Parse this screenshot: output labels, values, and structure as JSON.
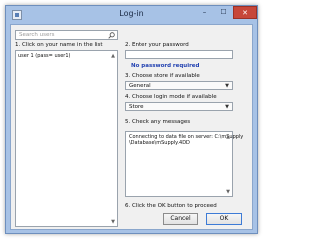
{
  "window": {
    "title": "Log-in",
    "controls": {
      "minimize": "–",
      "maximize": "☐",
      "close": "✕"
    }
  },
  "left": {
    "search_placeholder": "Search users",
    "step1_label": "1. Click on your name in the list",
    "users": [
      "user 1 (pass= user1)"
    ]
  },
  "right": {
    "step2_label": "2. Enter your password",
    "password_value": "",
    "no_password_note": "No password required",
    "step3_label": "3. Choose store if available",
    "store_value": "General",
    "step4_label": "4. Choose login mode if available",
    "mode_value": "Store",
    "step5_label": "5. Check any messages",
    "messages": [
      "Connecting to data file on server: C:\\mSupply",
      "\\Database\\mSupply.4DD"
    ],
    "step6_label": "6. Click the OK button to proceed"
  },
  "buttons": {
    "cancel": "Cancel",
    "ok": "OK"
  },
  "icons": {
    "app": "app-icon",
    "search": "search-icon",
    "dropdown": "chevron-down-icon",
    "scroll_up": "scroll-up-arrow-icon",
    "scroll_down": "scroll-down-arrow-icon"
  },
  "colors": {
    "window_frame": "#a7c2e6",
    "close_button": "#c7473a",
    "note_text": "#1f3fb0"
  }
}
